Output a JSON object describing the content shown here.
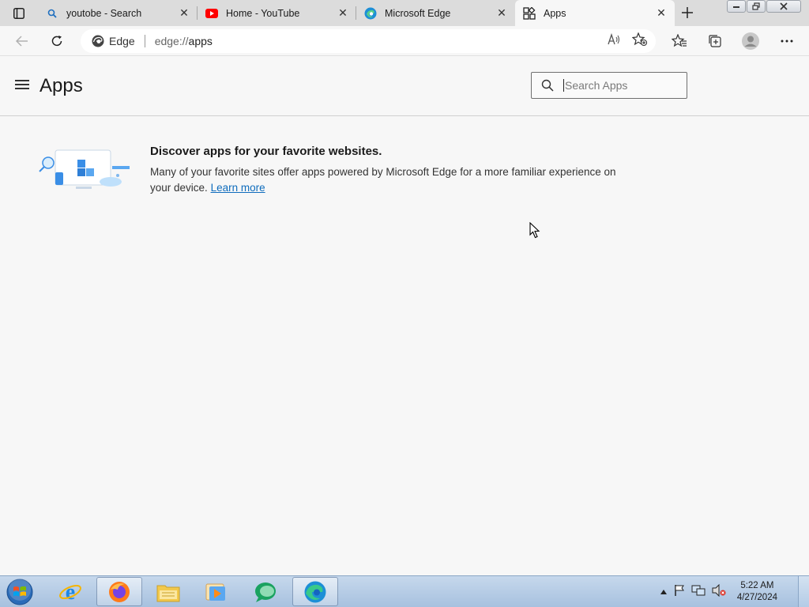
{
  "tabs": [
    {
      "title": "youtobe - Search",
      "icon": "search-icon",
      "active": false
    },
    {
      "title": "Home - YouTube",
      "icon": "youtube-icon",
      "active": false
    },
    {
      "title": "Microsoft Edge",
      "icon": "edge-icon",
      "active": false
    },
    {
      "title": "Apps",
      "icon": "apps-icon",
      "active": true
    }
  ],
  "address_bar": {
    "site_label": "Edge",
    "url_scheme": "edge://",
    "url_path": "apps"
  },
  "page": {
    "title": "Apps",
    "search_placeholder": "Search Apps"
  },
  "discover": {
    "title": "Discover apps for your favorite websites.",
    "body": "Many of your favorite sites offer apps powered by Microsoft Edge for a more familiar experience on your device.",
    "link": "Learn more"
  },
  "taskbar": {
    "apps": [
      "internet-explorer-icon",
      "firefox-icon",
      "file-explorer-icon",
      "media-player-icon",
      "chat-app-icon",
      "edge-icon"
    ],
    "time": "5:22 AM",
    "date": "4/27/2024"
  },
  "colors": {
    "accent": "#0f6cbd",
    "youtube_red": "#ff0000",
    "taskbar": "#a7c1df"
  }
}
